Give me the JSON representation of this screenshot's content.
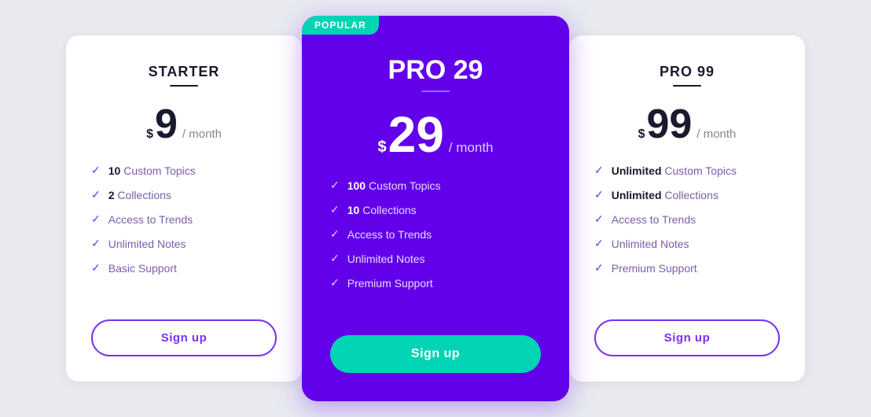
{
  "starter": {
    "title": "STARTER",
    "popular": false,
    "currency": "$",
    "amount": "9",
    "period": "/ month",
    "features": [
      {
        "bold": "10",
        "text": " Custom Topics"
      },
      {
        "bold": "2",
        "text": " Collections"
      },
      {
        "bold": "",
        "text": "Access to Trends"
      },
      {
        "bold": "",
        "text": "Unlimited Notes"
      },
      {
        "bold": "",
        "text": "Basic Support"
      }
    ],
    "button": "Sign up"
  },
  "pro29": {
    "title": "PRO 29",
    "popular": true,
    "popular_label": "POPULAR",
    "currency": "$",
    "amount": "29",
    "period": "/ month",
    "features": [
      {
        "bold": "100",
        "text": " Custom Topics"
      },
      {
        "bold": "10",
        "text": " Collections"
      },
      {
        "bold": "",
        "text": "Access to Trends"
      },
      {
        "bold": "",
        "text": "Unlimited Notes"
      },
      {
        "bold": "",
        "text": "Premium Support"
      }
    ],
    "button": "Sign up"
  },
  "pro99": {
    "title": "PRO 99",
    "popular": false,
    "currency": "$",
    "amount": "99",
    "period": "/ month",
    "features": [
      {
        "bold": "Unlimited",
        "text": " Custom Topics"
      },
      {
        "bold": "Unlimited",
        "text": " Collections"
      },
      {
        "bold": "",
        "text": "Access to Trends"
      },
      {
        "bold": "",
        "text": "Unlimited Notes"
      },
      {
        "bold": "",
        "text": "Premium Support"
      }
    ],
    "button": "Sign up"
  }
}
